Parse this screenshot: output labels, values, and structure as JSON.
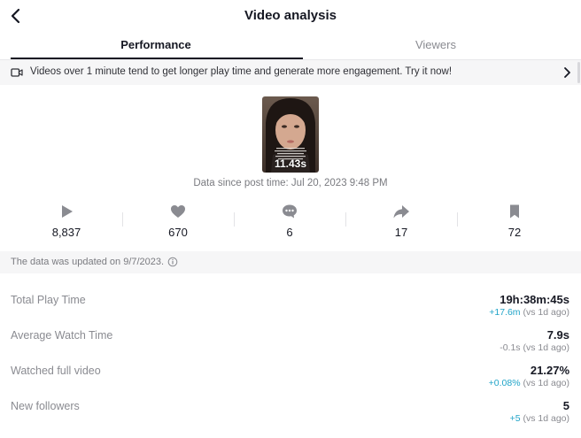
{
  "header": {
    "title": "Video analysis"
  },
  "tabs": [
    {
      "label": "Performance",
      "active": true
    },
    {
      "label": "Viewers",
      "active": false
    }
  ],
  "banner": {
    "text": "Videos over 1 minute tend to get longer play time and generate more engagement. Try it now!"
  },
  "video": {
    "duration": "11.43s",
    "since": "Data since post time: Jul 20, 2023 9:48 PM"
  },
  "metrics": [
    {
      "icon": "play-icon",
      "value": "8,837"
    },
    {
      "icon": "heart-icon",
      "value": "670"
    },
    {
      "icon": "comment-icon",
      "value": "6"
    },
    {
      "icon": "share-icon",
      "value": "17"
    },
    {
      "icon": "bookmark-icon",
      "value": "72"
    }
  ],
  "updated": {
    "text": "The data was updated on 9/7/2023."
  },
  "stats": [
    {
      "label": "Total Play Time",
      "value": "19h:38m:45s",
      "delta": "+17.6m",
      "delta_type": "positive",
      "compare": "(vs 1d ago)"
    },
    {
      "label": "Average Watch Time",
      "value": "7.9s",
      "delta": "-0.1s",
      "delta_type": "negative",
      "compare": "(vs 1d ago)"
    },
    {
      "label": "Watched full video",
      "value": "21.27%",
      "delta": "+0.08%",
      "delta_type": "positive",
      "compare": "(vs 1d ago)"
    },
    {
      "label": "New followers",
      "value": "5",
      "delta": "+5",
      "delta_type": "positive",
      "compare": "(vs 1d ago)"
    }
  ],
  "colors": {
    "text": "#161823",
    "muted": "#8a8b91",
    "positive": "#20a4c8",
    "icon": "#8a8b91",
    "panel": "#f6f6f7"
  }
}
